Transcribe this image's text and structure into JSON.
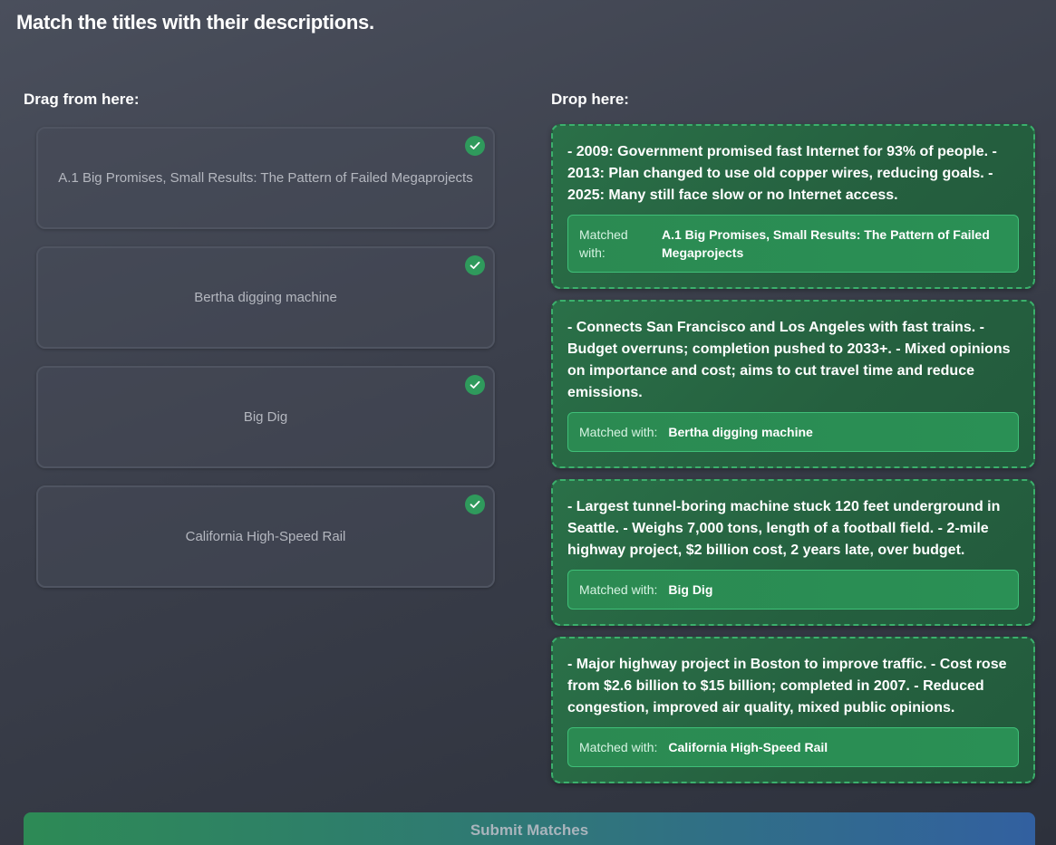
{
  "page": {
    "title": "Match the titles with their descriptions."
  },
  "drag_section": {
    "heading": "Drag from here:",
    "items": [
      {
        "label": "A.1 Big Promises, Small Results: The Pattern of Failed Megaprojects",
        "status_icon": "check-circle-icon"
      },
      {
        "label": "Bertha digging machine",
        "status_icon": "check-circle-icon"
      },
      {
        "label": "Big Dig",
        "status_icon": "check-circle-icon"
      },
      {
        "label": "California High-Speed Rail",
        "status_icon": "check-circle-icon"
      }
    ]
  },
  "drop_section": {
    "heading": "Drop here:",
    "matched_label": "Matched with:",
    "zones": [
      {
        "description": "- 2009: Government promised fast Internet for 93% of people. - 2013: Plan changed to use old copper wires, reducing goals. - 2025: Many still face slow or no Internet access.",
        "matched": "A.1 Big Promises, Small Results: The Pattern of Failed Megaprojects"
      },
      {
        "description": "- Connects San Francisco and Los Angeles with fast trains. - Budget overruns; completion pushed to 2033+. - Mixed opinions on importance and cost; aims to cut travel time and reduce emissions.",
        "matched": "Bertha digging machine"
      },
      {
        "description": "- Largest tunnel-boring machine stuck 120 feet underground in Seattle. - Weighs 7,000 tons, length of a football field. - 2-mile highway project, $2 billion cost, 2 years late, over budget.",
        "matched": "Big Dig"
      },
      {
        "description": "- Major highway project in Boston to improve traffic. - Cost rose from $2.6 billion to $15 billion; completed in 2007. - Reduced congestion, improved air quality, mixed public opinions.",
        "matched": "California High-Speed Rail"
      }
    ]
  },
  "submit": {
    "label": "Submit Matches"
  },
  "colors": {
    "check_green": "#2f9a5c",
    "drop_border": "#3bb06c",
    "drop_bg": "#25603f"
  }
}
